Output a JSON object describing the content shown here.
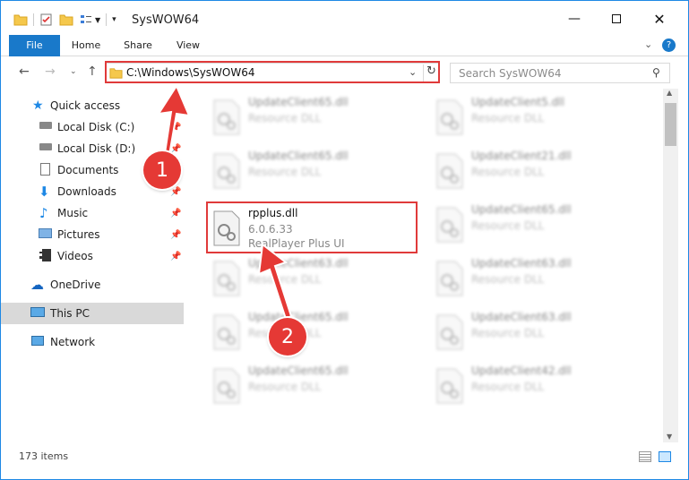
{
  "window": {
    "title": "SysWOW64"
  },
  "ribbon": {
    "tabs": [
      "File",
      "Home",
      "Share",
      "View"
    ]
  },
  "address": {
    "path": "C:\\Windows\\SysWOW64"
  },
  "search": {
    "placeholder": "Search SysWOW64"
  },
  "nav": {
    "items": [
      {
        "label": "Quick access",
        "icon": "star-icon"
      },
      {
        "label": "Local Disk (C:)",
        "icon": "drive-icon",
        "pinned": true
      },
      {
        "label": "Local Disk (D:)",
        "icon": "drive-icon",
        "pinned": true
      },
      {
        "label": "Documents",
        "icon": "documents-icon",
        "pinned": true
      },
      {
        "label": "Downloads",
        "icon": "downloads-icon",
        "pinned": true
      },
      {
        "label": "Music",
        "icon": "music-icon",
        "pinned": true
      },
      {
        "label": "Pictures",
        "icon": "pictures-icon",
        "pinned": true
      },
      {
        "label": "Videos",
        "icon": "videos-icon",
        "pinned": true
      },
      {
        "label": "OneDrive",
        "icon": "cloud-icon"
      },
      {
        "label": "This PC",
        "icon": "computer-icon",
        "selected": true
      },
      {
        "label": "Network",
        "icon": "network-icon"
      }
    ]
  },
  "files": [
    {
      "name": "UpdateClient65.dll",
      "type": "Resource DLL"
    },
    {
      "name": "UpdateClient5.dll",
      "type": "Resource DLL"
    },
    {
      "name": "UpdateClient65.dll",
      "type": "Resource DLL"
    },
    {
      "name": "UpdateClient21.dll",
      "type": "Resource DLL"
    },
    {
      "name": "rpplus.dll",
      "version": "6.0.6.33",
      "type": "RealPlayer Plus UI",
      "highlighted": true
    },
    {
      "name": "UpdateClient65.dll",
      "type": "Resource DLL"
    },
    {
      "name": "UpdateClient63.dll",
      "type": "Resource DLL"
    },
    {
      "name": "UpdateClient63.dll",
      "type": "Resource DLL"
    },
    {
      "name": "UpdateClient65.dll",
      "type": "Resource DLL"
    },
    {
      "name": "UpdateClient63.dll",
      "type": "Resource DLL"
    },
    {
      "name": "UpdateClient65.dll",
      "type": "Resource DLL"
    },
    {
      "name": "UpdateClient42.dll",
      "type": "Resource DLL"
    }
  ],
  "status": {
    "count": "173 items"
  },
  "annotations": {
    "step1": "1",
    "step2": "2",
    "color": "#e53935"
  }
}
